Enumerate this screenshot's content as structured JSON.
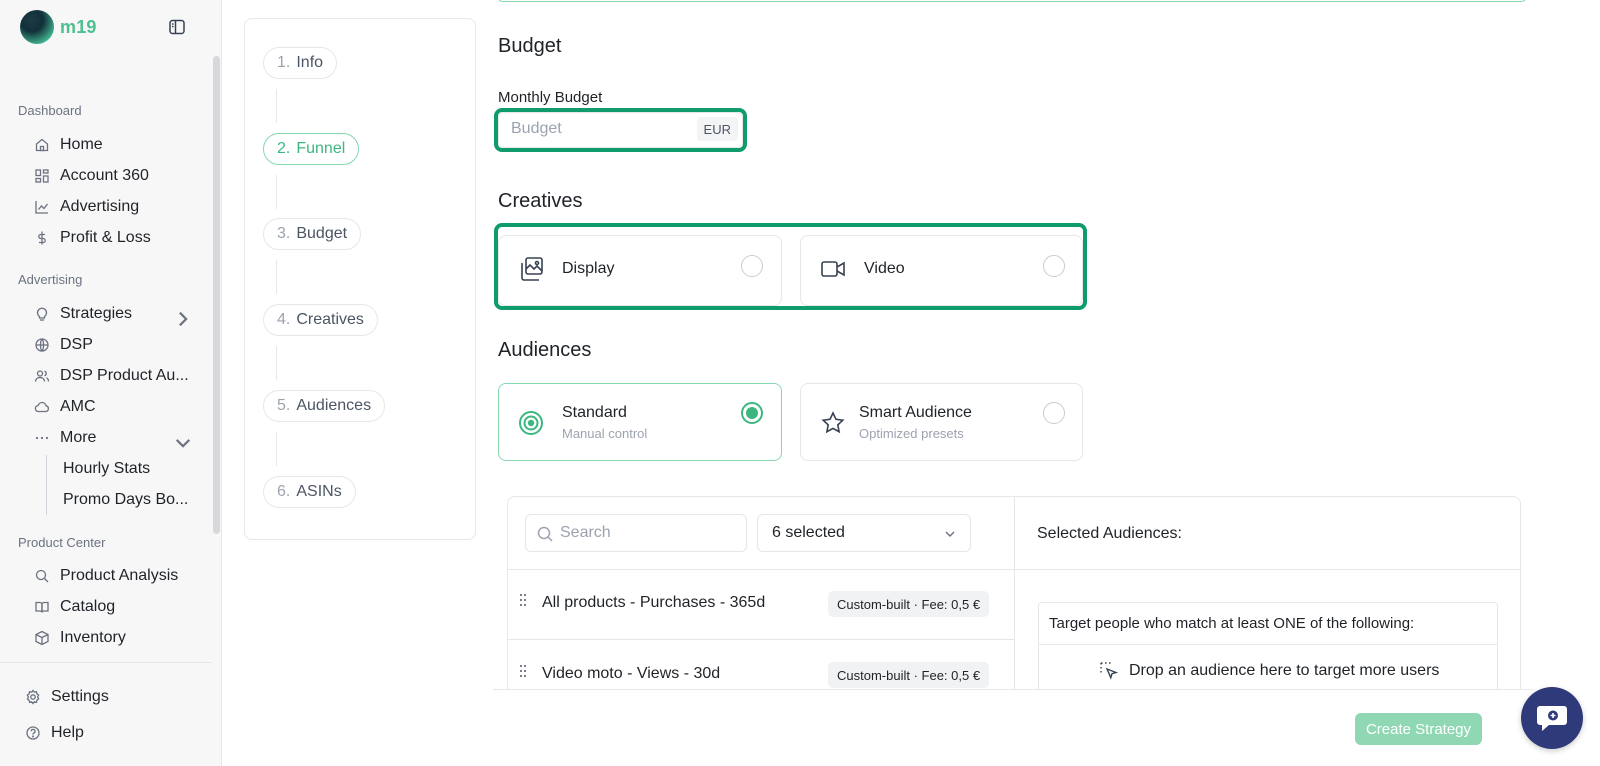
{
  "app": {
    "logo_text": "m19"
  },
  "sidebar": {
    "sections": {
      "dashboard": "Dashboard",
      "advertising": "Advertising",
      "product_center": "Product Center"
    },
    "items": {
      "home": "Home",
      "account360": "Account 360",
      "advertising": "Advertising",
      "profit_loss": "Profit & Loss",
      "strategies": "Strategies",
      "dsp": "DSP",
      "dsp_product_audiences": "DSP Product Au...",
      "amc": "AMC",
      "more": "More",
      "hourly_stats": "Hourly Stats",
      "promo_days": "Promo Days Bo...",
      "product_analysis": "Product Analysis",
      "catalog": "Catalog",
      "inventory": "Inventory",
      "settings": "Settings",
      "help": "Help"
    }
  },
  "stepper": {
    "steps": [
      {
        "num": "1.",
        "label": "Info",
        "active": false
      },
      {
        "num": "2.",
        "label": "Funnel",
        "active": true
      },
      {
        "num": "3.",
        "label": "Budget",
        "active": false
      },
      {
        "num": "4.",
        "label": "Creatives",
        "active": false
      },
      {
        "num": "5.",
        "label": "Audiences",
        "active": false
      },
      {
        "num": "6.",
        "label": "ASINs",
        "active": false
      }
    ]
  },
  "budget": {
    "heading": "Budget",
    "monthly_label": "Monthly Budget",
    "placeholder": "Budget",
    "currency": "EUR"
  },
  "creatives": {
    "heading": "Creatives",
    "display": "Display",
    "video": "Video"
  },
  "audiences": {
    "heading": "Audiences",
    "standard_title": "Standard",
    "standard_desc": "Manual control",
    "smart_title": "Smart Audience",
    "smart_desc": "Optimized presets",
    "selected_option": "standard",
    "search_placeholder": "Search",
    "selected_count": "6 selected",
    "rows": [
      {
        "name": "All products - Purchases - 365d",
        "tag": "Custom-built · Fee: 0,5 €"
      },
      {
        "name": "Video moto - Views - 30d",
        "tag": "Custom-built · Fee: 0,5 €"
      }
    ],
    "selected_title": "Selected Audiences:",
    "target_rule": "Target people who match at least ONE of the following:",
    "drop_hint": "Drop an audience here to target more users"
  },
  "actions": {
    "create": "Create Strategy"
  },
  "colors": {
    "accent": "#3cb77f",
    "highlight": "#0f9b6c",
    "chat": "#2f3a7a"
  }
}
